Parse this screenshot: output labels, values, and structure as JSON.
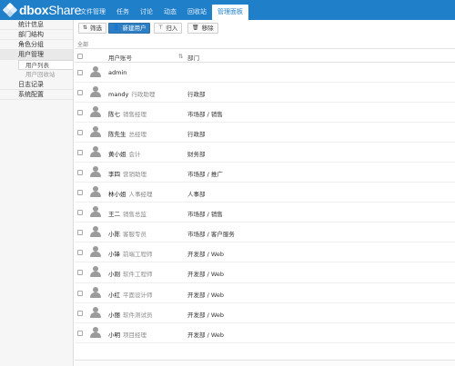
{
  "app": {
    "logo_prefix": "dbox",
    "logo_suffix": "Share"
  },
  "nav": {
    "items": [
      {
        "label": "文件管理"
      },
      {
        "label": "任务"
      },
      {
        "label": "讨论"
      },
      {
        "label": "动态"
      },
      {
        "label": "回收站"
      },
      {
        "label": "管理面板"
      }
    ],
    "active": "管理面板"
  },
  "sidebar": {
    "items": [
      {
        "label": "统计信息"
      },
      {
        "label": "部门结构"
      },
      {
        "label": "角色分组"
      },
      {
        "label": "用户管理"
      },
      {
        "label": "日志记录"
      },
      {
        "label": "系统配置"
      }
    ],
    "sub_items": [
      {
        "label": "用户列表"
      },
      {
        "label": "用户回收站"
      }
    ]
  },
  "toolbar": {
    "filter_label": "筛选",
    "new_user_label": "新建用户",
    "import_label": "归入",
    "remove_label": "移除"
  },
  "list": {
    "scope_label": "全部",
    "columns": {
      "account": "用户账号",
      "department": "部门"
    },
    "rows": [
      {
        "name": "admin",
        "title": "",
        "dept": ""
      },
      {
        "name": "mandy",
        "title": "行政助理",
        "dept": "行政部"
      },
      {
        "name": "陈七",
        "title": "销售经理",
        "dept": "市场部 / 销售"
      },
      {
        "name": "陈先生",
        "title": "总经理",
        "dept": "行政部"
      },
      {
        "name": "黄小姐",
        "title": "会计",
        "dept": "财务部"
      },
      {
        "name": "李四",
        "title": "营销助理",
        "dept": "市场部 / 推广"
      },
      {
        "name": "林小姐",
        "title": "人事经理",
        "dept": "人事部"
      },
      {
        "name": "王二",
        "title": "销售总监",
        "dept": "市场部 / 销售"
      },
      {
        "name": "小陈",
        "title": "客服专员",
        "dept": "市场部 / 客户服务"
      },
      {
        "name": "小锋",
        "title": "前端工程师",
        "dept": "开发部 / Web"
      },
      {
        "name": "小刚",
        "title": "软件工程师",
        "dept": "开发部 / Web"
      },
      {
        "name": "小红",
        "title": "平面设计师",
        "dept": "开发部 / Web"
      },
      {
        "name": "小丽",
        "title": "软件测试员",
        "dept": "开发部 / Web"
      },
      {
        "name": "小明",
        "title": "项目经理",
        "dept": "开发部 / Web"
      }
    ]
  },
  "colors": {
    "brand": "#1f7fc8",
    "primary_button": "#2d7ec2",
    "sidebar_bg": "#f6f6f6"
  },
  "icons": {
    "filter": "filter-icon",
    "new_user": "add-user-icon",
    "import": "import-icon",
    "remove": "trash-icon",
    "avatar": "user-avatar-icon",
    "sort": "sort-icon"
  }
}
